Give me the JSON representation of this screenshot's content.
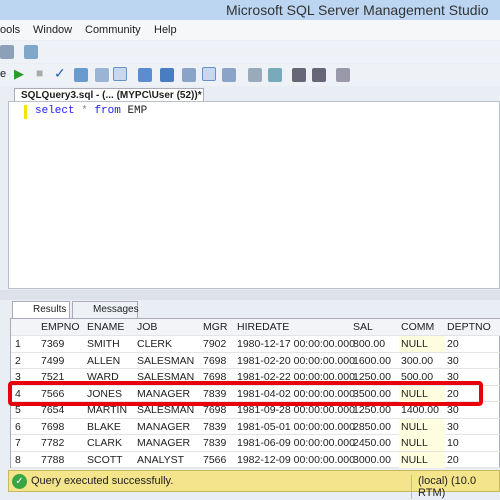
{
  "window": {
    "title": "Microsoft SQL Server Management Studio"
  },
  "menu": [
    "ools",
    "Window",
    "Community",
    "Help"
  ],
  "toolbar": {
    "execute_label": "e"
  },
  "editor": {
    "tab_label": "SQLQuery3.sql - (... (MYPC\\User (52))*",
    "query": {
      "kw1": "select",
      "op": "*",
      "kw2": "from",
      "table": "EMP"
    }
  },
  "results": {
    "tabs": [
      "Results",
      "Messages"
    ],
    "columns": [
      "",
      "EMPNO",
      "ENAME",
      "JOB",
      "MGR",
      "HIREDATE",
      "SAL",
      "COMM",
      "DEPTNO"
    ],
    "rows": [
      [
        "1",
        "7369",
        "SMITH",
        "CLERK",
        "7902",
        "1980-12-17 00:00:00.000",
        "800.00",
        "NULL",
        "20"
      ],
      [
        "2",
        "7499",
        "ALLEN",
        "SALESMAN",
        "7698",
        "1981-02-20 00:00:00.000",
        "1600.00",
        "300.00",
        "30"
      ],
      [
        "3",
        "7521",
        "WARD",
        "SALESMAN",
        "7698",
        "1981-02-22 00:00:00.000",
        "1250.00",
        "500.00",
        "30"
      ],
      [
        "4",
        "7566",
        "JONES",
        "MANAGER",
        "7839",
        "1981-04-02 00:00:00.000",
        "3500.00",
        "NULL",
        "20"
      ],
      [
        "5",
        "7654",
        "MARTIN",
        "SALESMAN",
        "7698",
        "1981-09-28 00:00:00.000",
        "1250.00",
        "1400.00",
        "30"
      ],
      [
        "6",
        "7698",
        "BLAKE",
        "MANAGER",
        "7839",
        "1981-05-01 00:00:00.000",
        "2850.00",
        "NULL",
        "30"
      ],
      [
        "7",
        "7782",
        "CLARK",
        "MANAGER",
        "7839",
        "1981-06-09 00:00:00.000",
        "2450.00",
        "NULL",
        "10"
      ],
      [
        "8",
        "7788",
        "SCOTT",
        "ANALYST",
        "7566",
        "1982-12-09 00:00:00.000",
        "3000.00",
        "NULL",
        "20"
      ]
    ],
    "highlighted_row": "4"
  },
  "status": {
    "message": "Query executed successfully.",
    "server": "(local) (10.0 RTM)"
  },
  "colors": {
    "highlight": "#e8000a",
    "status_bg": "#f4e48c",
    "keyword": "#2020ff"
  }
}
